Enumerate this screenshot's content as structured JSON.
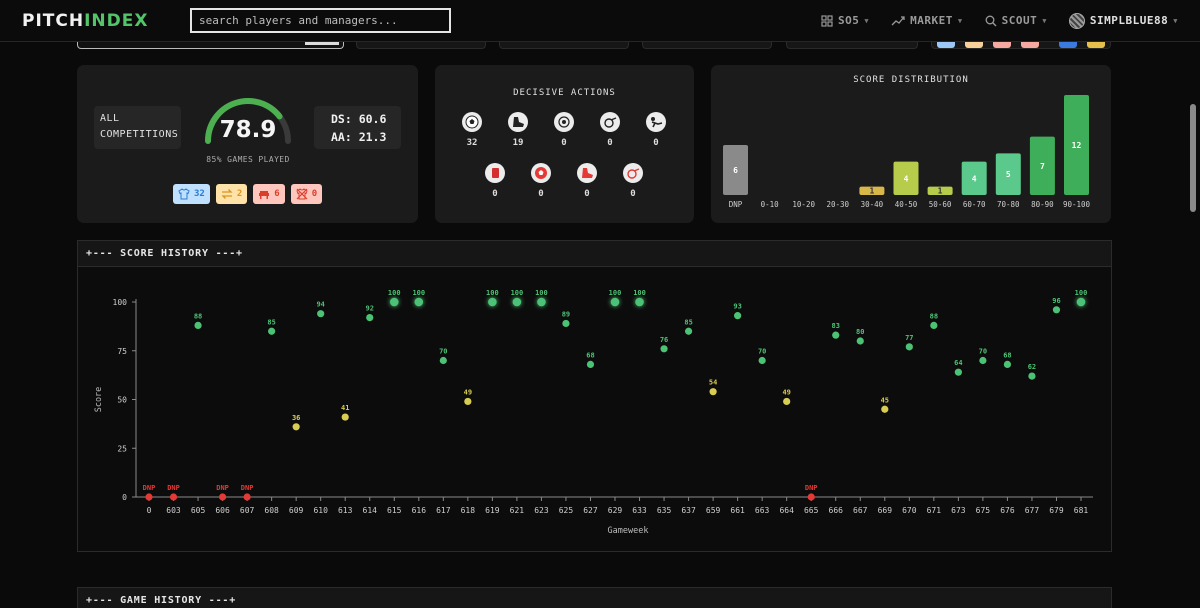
{
  "app": {
    "logo_left": "PITCH",
    "logo_right": "INDEX"
  },
  "search": {
    "placeholder": "search players and managers..."
  },
  "nav": [
    {
      "label": "SO5",
      "icon": "grid-icon"
    },
    {
      "label": "MARKET",
      "icon": "trend-icon"
    },
    {
      "label": "SCOUT",
      "icon": "search-icon"
    },
    {
      "label": "SIMPLBLUE88",
      "icon": "avatar"
    }
  ],
  "summary": {
    "competition_line1": "ALL",
    "competition_line2": "COMPETITIONS",
    "score": "78.9",
    "score_value": 78.9,
    "games_played": "85% GAMES PLAYED",
    "ds": "DS: 60.6",
    "aa": "AA: 21.3",
    "badges": [
      {
        "name": "starts",
        "icon": "shirt-icon",
        "value": "32",
        "bg": "#bfe0ff",
        "fg": "#2b7bd3"
      },
      {
        "name": "subs",
        "icon": "swap-icon",
        "value": "2",
        "bg": "#ffe2a8",
        "fg": "#d89520"
      },
      {
        "name": "bench",
        "icon": "bench-icon",
        "value": "6",
        "bg": "#ffc6bd",
        "fg": "#d8402c"
      },
      {
        "name": "not-in-squad",
        "icon": "no-squad-icon",
        "value": "0",
        "bg": "#ffc6bd",
        "fg": "#d8402c"
      }
    ]
  },
  "decisive": {
    "title": "DECISIVE ACTIONS",
    "row1": [
      {
        "icon": "goal-ball-icon",
        "value": "32"
      },
      {
        "icon": "boot-icon",
        "value": "19"
      },
      {
        "icon": "penalty-won-icon",
        "value": "0"
      },
      {
        "icon": "whistle-icon",
        "value": "0"
      },
      {
        "icon": "clearance-icon",
        "value": "0"
      }
    ],
    "row2": [
      {
        "icon": "red-card-icon",
        "value": "0"
      },
      {
        "icon": "own-goal-icon",
        "value": "0"
      },
      {
        "icon": "error-boot-icon",
        "value": "0"
      },
      {
        "icon": "penalty-conceded-icon",
        "value": "0"
      }
    ]
  },
  "distribution": {
    "title": "SCORE DISTRIBUTION",
    "chart_data": {
      "type": "bar",
      "categories": [
        "DNP",
        "0-10",
        "10-20",
        "20-30",
        "30-40",
        "40-50",
        "50-60",
        "60-70",
        "70-80",
        "80-90",
        "90-100"
      ],
      "values": [
        6,
        0,
        0,
        0,
        1,
        4,
        1,
        4,
        5,
        7,
        12
      ],
      "colors": [
        "#8a8a8a",
        "#8a8a8a",
        "#8a8a8a",
        "#8a8a8a",
        "#d9b64a",
        "#b7cc4a",
        "#b7cc4a",
        "#5cc98c",
        "#5cc98c",
        "#3fae5a",
        "#3fae5a"
      ]
    }
  },
  "history": {
    "title": "+--- SCORE HISTORY ---+",
    "chart_data": {
      "type": "scatter",
      "xlabel": "Gameweek",
      "ylabel": "Score",
      "ylim": [
        0,
        100
      ],
      "yticks": [
        0,
        25,
        50,
        75,
        100
      ],
      "categories": [
        "0",
        "603",
        "605",
        "606",
        "607",
        "608",
        "609",
        "610",
        "613",
        "614",
        "615",
        "616",
        "617",
        "618",
        "619",
        "621",
        "623",
        "625",
        "627",
        "629",
        "633",
        "635",
        "637",
        "659",
        "661",
        "663",
        "664",
        "665",
        "666",
        "667",
        "669",
        "670",
        "671",
        "673",
        "675",
        "676",
        "677",
        "679",
        "681"
      ],
      "values": [
        0,
        0,
        88,
        0,
        0,
        85,
        36,
        94,
        41,
        92,
        100,
        100,
        70,
        49,
        100,
        100,
        100,
        89,
        68,
        100,
        100,
        76,
        85,
        54,
        93,
        70,
        49,
        0,
        83,
        80,
        45,
        77,
        88,
        64,
        70,
        68,
        62,
        96,
        100
      ],
      "labels": [
        "DNP",
        "DNP",
        "88",
        "DNP",
        "DNP",
        "85",
        "36",
        "94",
        "41",
        "92",
        "100",
        "100",
        "70",
        "49",
        "100",
        "100",
        "100",
        "89",
        "68",
        "100",
        "100",
        "76",
        "85",
        "54",
        "93",
        "70",
        "49",
        "DNP",
        "83",
        "80",
        "45",
        "77",
        "88",
        "64",
        "70",
        "68",
        "62",
        "96",
        "100"
      ],
      "dnp": [
        true,
        true,
        false,
        true,
        true,
        false,
        false,
        false,
        false,
        false,
        false,
        false,
        false,
        false,
        false,
        false,
        false,
        false,
        false,
        false,
        false,
        false,
        false,
        false,
        false,
        false,
        false,
        true,
        false,
        false,
        false,
        false,
        false,
        false,
        false,
        false,
        false,
        false,
        false
      ]
    }
  },
  "game_history": {
    "title": "+--- GAME HISTORY ---+"
  }
}
